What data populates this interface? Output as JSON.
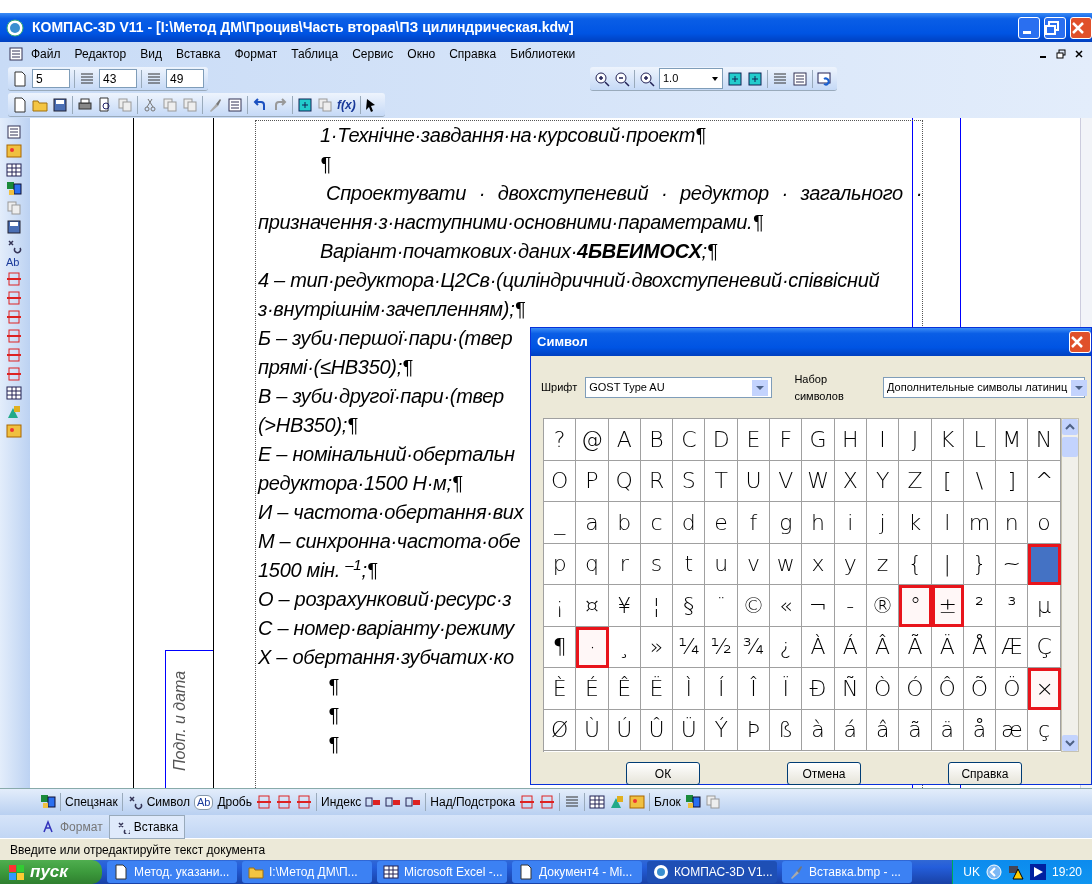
{
  "window": {
    "title": "КОМПАС-3D V11 - [I:\\Метод ДМ\\Процив\\Часть вторая\\ПЗ цилиндрическая.kdw]"
  },
  "menu": [
    "Файл",
    "Редактор",
    "Вид",
    "Вставка",
    "Формат",
    "Таблица",
    "Сервис",
    "Окно",
    "Справка",
    "Библиотеки"
  ],
  "toolbar": {
    "fields": [
      "5",
      "43",
      "49"
    ],
    "zoom": "1.0",
    "formula_button": "f(x)"
  },
  "side_toolbar": {
    "fraction_icon_text": "Ab"
  },
  "document": {
    "stamp_label": "Подп. и дата",
    "lines": [
      {
        "kind": "indented",
        "text": "1·Технічне·завдання·на·курсовий·проект¶"
      },
      {
        "kind": "indented",
        "text": "¶"
      },
      {
        "kind": "justified",
        "text": "Спроектувати · двохступеневий · редуктор · загального ·"
      },
      {
        "kind": "plain",
        "text": "призначення·з·наступними·основними·параметрами.¶"
      },
      {
        "kind": "indented",
        "text": "Варіант·початкових·даних·**4БВЕИМОСХ**;¶"
      },
      {
        "kind": "plain",
        "text": "4 – тип·редуктора·Ц2Св·(циліндричний·двохступеневий·співвісний"
      },
      {
        "kind": "plain",
        "text": "з·внутрішнім·зачепленням);¶"
      },
      {
        "kind": "plain",
        "text": "Б – зуби·першої·пари·(твер"
      },
      {
        "kind": "plain",
        "text": "прямі·(≤HB350);¶"
      },
      {
        "kind": "plain",
        "text": "В – зуби·другої·пари·(твер"
      },
      {
        "kind": "plain",
        "text": "(>HB350);¶"
      },
      {
        "kind": "plain",
        "text": "Е – номінальний·обертальн"
      },
      {
        "kind": "plain",
        "text": "редуктора·1500 Н·м;¶"
      },
      {
        "kind": "plain",
        "text": "И – частота·обертання·вих"
      },
      {
        "kind": "plain",
        "text": "М – синхронна·частота·обе"
      },
      {
        "kind": "plain",
        "text": "1500 мін. $^{–1}$;¶"
      },
      {
        "kind": "plain",
        "text": "О – розрахунковий·ресурс·з"
      },
      {
        "kind": "plain",
        "text": "С – номер·варіанту·режиму"
      },
      {
        "kind": "plain",
        "text": "Х – обертання·зубчатих·ко"
      },
      {
        "kind": "deep",
        "text": "¶"
      },
      {
        "kind": "deep",
        "text": "¶"
      },
      {
        "kind": "deep",
        "text": "¶"
      }
    ]
  },
  "dialog": {
    "title": "Символ",
    "font_label": "Шрифт",
    "font": "GOST Type AU",
    "set_label": "Набор символов",
    "set": "Дополнительные символы латиниц",
    "grid": [
      [
        {
          "char": "?",
          "selected": false,
          "highlighted": false
        },
        {
          "char": "@",
          "selected": false,
          "highlighted": false
        },
        {
          "char": "A",
          "selected": false,
          "highlighted": false
        },
        {
          "char": "B",
          "selected": false,
          "highlighted": false
        },
        {
          "char": "C",
          "selected": false,
          "highlighted": false
        },
        {
          "char": "D",
          "selected": false,
          "highlighted": false
        },
        {
          "char": "E",
          "selected": false,
          "highlighted": false
        },
        {
          "char": "F",
          "selected": false,
          "highlighted": false
        },
        {
          "char": "G",
          "selected": false,
          "highlighted": false
        },
        {
          "char": "H",
          "selected": false,
          "highlighted": false
        },
        {
          "char": "I",
          "selected": false,
          "highlighted": false
        },
        {
          "char": "J",
          "selected": false,
          "highlighted": false
        },
        {
          "char": "K",
          "selected": false,
          "highlighted": false
        },
        {
          "char": "L",
          "selected": false,
          "highlighted": false
        },
        {
          "char": "M",
          "selected": false,
          "highlighted": false
        },
        {
          "char": "N",
          "selected": false,
          "highlighted": false
        }
      ],
      [
        {
          "char": "O",
          "selected": false,
          "highlighted": false
        },
        {
          "char": "P",
          "selected": false,
          "highlighted": false
        },
        {
          "char": "Q",
          "selected": false,
          "highlighted": false
        },
        {
          "char": "R",
          "selected": false,
          "highlighted": false
        },
        {
          "char": "S",
          "selected": false,
          "highlighted": false
        },
        {
          "char": "T",
          "selected": false,
          "highlighted": false
        },
        {
          "char": "U",
          "selected": false,
          "highlighted": false
        },
        {
          "char": "V",
          "selected": false,
          "highlighted": false
        },
        {
          "char": "W",
          "selected": false,
          "highlighted": false
        },
        {
          "char": "X",
          "selected": false,
          "highlighted": false
        },
        {
          "char": "Y",
          "selected": false,
          "highlighted": false
        },
        {
          "char": "Z",
          "selected": false,
          "highlighted": false
        },
        {
          "char": "[",
          "selected": false,
          "highlighted": false
        },
        {
          "char": "\\",
          "selected": false,
          "highlighted": false
        },
        {
          "char": "]",
          "selected": false,
          "highlighted": false
        },
        {
          "char": "^",
          "selected": false,
          "highlighted": false
        }
      ],
      [
        {
          "char": "_",
          "selected": false,
          "highlighted": false
        },
        {
          "char": "a",
          "selected": false,
          "highlighted": false
        },
        {
          "char": "b",
          "selected": false,
          "highlighted": false
        },
        {
          "char": "c",
          "selected": false,
          "highlighted": false
        },
        {
          "char": "d",
          "selected": false,
          "highlighted": false
        },
        {
          "char": "e",
          "selected": false,
          "highlighted": false
        },
        {
          "char": "f",
          "selected": false,
          "highlighted": false
        },
        {
          "char": "g",
          "selected": false,
          "highlighted": false
        },
        {
          "char": "h",
          "selected": false,
          "highlighted": false
        },
        {
          "char": "i",
          "selected": false,
          "highlighted": false
        },
        {
          "char": "j",
          "selected": false,
          "highlighted": false
        },
        {
          "char": "k",
          "selected": false,
          "highlighted": false
        },
        {
          "char": "l",
          "selected": false,
          "highlighted": false
        },
        {
          "char": "m",
          "selected": false,
          "highlighted": false
        },
        {
          "char": "n",
          "selected": false,
          "highlighted": false
        },
        {
          "char": "o",
          "selected": false,
          "highlighted": false
        }
      ],
      [
        {
          "char": "p",
          "selected": false,
          "highlighted": false
        },
        {
          "char": "q",
          "selected": false,
          "highlighted": false
        },
        {
          "char": "r",
          "selected": false,
          "highlighted": false
        },
        {
          "char": "s",
          "selected": false,
          "highlighted": false
        },
        {
          "char": "t",
          "selected": false,
          "highlighted": false
        },
        {
          "char": "u",
          "selected": false,
          "highlighted": false
        },
        {
          "char": "v",
          "selected": false,
          "highlighted": false
        },
        {
          "char": "w",
          "selected": false,
          "highlighted": false
        },
        {
          "char": "x",
          "selected": false,
          "highlighted": false
        },
        {
          "char": "y",
          "selected": false,
          "highlighted": false
        },
        {
          "char": "z",
          "selected": false,
          "highlighted": false
        },
        {
          "char": "{",
          "selected": false,
          "highlighted": false
        },
        {
          "char": "|",
          "selected": false,
          "highlighted": false
        },
        {
          "char": "}",
          "selected": false,
          "highlighted": false
        },
        {
          "char": "~",
          "selected": false,
          "highlighted": false
        },
        {
          "selected": true,
          "highlighted": true
        }
      ],
      [
        {
          "char": "¡",
          "selected": false,
          "highlighted": false
        },
        {
          "char": "¤",
          "selected": false,
          "highlighted": false
        },
        {
          "char": "¥",
          "selected": false,
          "highlighted": false
        },
        {
          "char": "¦",
          "selected": false,
          "highlighted": false
        },
        {
          "char": "§",
          "selected": false,
          "highlighted": false
        },
        {
          "char": "¨",
          "selected": false,
          "highlighted": false
        },
        {
          "char": "©",
          "selected": false,
          "highlighted": false
        },
        {
          "char": "«",
          "selected": false,
          "highlighted": false
        },
        {
          "char": "¬",
          "selected": false,
          "highlighted": false
        },
        {
          "char": "-",
          "selected": false,
          "highlighted": false
        },
        {
          "char": "®",
          "selected": false,
          "highlighted": false
        },
        {
          "char": "°",
          "selected": false,
          "highlighted": true
        },
        {
          "char": "±",
          "selected": false,
          "highlighted": true
        },
        {
          "char": "²",
          "selected": false,
          "highlighted": false
        },
        {
          "char": "³",
          "selected": false,
          "highlighted": false
        },
        {
          "char": "µ",
          "selected": false,
          "highlighted": false
        }
      ],
      [
        {
          "char": "¶",
          "selected": false,
          "highlighted": false
        },
        {
          "char": "·",
          "selected": false,
          "highlighted": true
        },
        {
          "char": "¸",
          "selected": false,
          "highlighted": false
        },
        {
          "char": "»",
          "selected": false,
          "highlighted": false
        },
        {
          "char": "¼",
          "selected": false,
          "highlighted": false
        },
        {
          "char": "½",
          "selected": false,
          "highlighted": false
        },
        {
          "char": "¾",
          "selected": false,
          "highlighted": false
        },
        {
          "char": "¿",
          "selected": false,
          "highlighted": false
        },
        {
          "char": "À",
          "selected": false,
          "highlighted": false
        },
        {
          "char": "Á",
          "selected": false,
          "highlighted": false
        },
        {
          "char": "Â",
          "selected": false,
          "highlighted": false
        },
        {
          "char": "Ã",
          "selected": false,
          "highlighted": false
        },
        {
          "char": "Ä",
          "selected": false,
          "highlighted": false
        },
        {
          "char": "Å",
          "selected": false,
          "highlighted": false
        },
        {
          "char": "Æ",
          "selected": false,
          "highlighted": false
        },
        {
          "char": "Ç",
          "selected": false,
          "highlighted": false
        }
      ],
      [
        {
          "char": "È",
          "selected": false,
          "highlighted": false
        },
        {
          "char": "É",
          "selected": false,
          "highlighted": false
        },
        {
          "char": "Ê",
          "selected": false,
          "highlighted": false
        },
        {
          "char": "Ë",
          "selected": false,
          "highlighted": false
        },
        {
          "char": "Ì",
          "selected": false,
          "highlighted": false
        },
        {
          "char": "Í",
          "selected": false,
          "highlighted": false
        },
        {
          "char": "Î",
          "selected": false,
          "highlighted": false
        },
        {
          "char": "Ï",
          "selected": false,
          "highlighted": false
        },
        {
          "char": "Ð",
          "selected": false,
          "highlighted": false
        },
        {
          "char": "Ñ",
          "selected": false,
          "highlighted": false
        },
        {
          "char": "Ò",
          "selected": false,
          "highlighted": false
        },
        {
          "char": "Ó",
          "selected": false,
          "highlighted": false
        },
        {
          "char": "Ô",
          "selected": false,
          "highlighted": false
        },
        {
          "char": "Õ",
          "selected": false,
          "highlighted": false
        },
        {
          "char": "Ö",
          "selected": false,
          "highlighted": false
        },
        {
          "char": "×",
          "selected": false,
          "highlighted": true
        }
      ],
      [
        {
          "char": "Ø",
          "selected": false,
          "highlighted": false
        },
        {
          "char": "Ù",
          "selected": false,
          "highlighted": false
        },
        {
          "char": "Ú",
          "selected": false,
          "highlighted": false
        },
        {
          "char": "Û",
          "selected": false,
          "highlighted": false
        },
        {
          "char": "Ü",
          "selected": false,
          "highlighted": false
        },
        {
          "char": "Ý",
          "selected": false,
          "highlighted": false
        },
        {
          "char": "Þ",
          "selected": false,
          "highlighted": false
        },
        {
          "char": "ß",
          "selected": false,
          "highlighted": false
        },
        {
          "char": "à",
          "selected": false,
          "highlighted": false
        },
        {
          "char": "á",
          "selected": false,
          "highlighted": false
        },
        {
          "char": "â",
          "selected": false,
          "highlighted": false
        },
        {
          "char": "ã",
          "selected": false,
          "highlighted": false
        },
        {
          "char": "ä",
          "selected": false,
          "highlighted": false
        },
        {
          "char": "å",
          "selected": false,
          "highlighted": false
        },
        {
          "char": "æ",
          "selected": false,
          "highlighted": false
        },
        {
          "char": "ç",
          "selected": false,
          "highlighted": false
        }
      ]
    ],
    "buttons": [
      "ОК",
      "Отмена",
      "Справка"
    ]
  },
  "format_toolbar": {
    "fraction_icon_text": "Ab",
    "labels": [
      "Спецзнак",
      "Символ",
      "Дробь",
      "Индекс",
      "Над/Подстрока",
      "Блок"
    ]
  },
  "tabs": [
    {
      "label": "Формат",
      "selected": false
    },
    {
      "label": "Вставка",
      "selected": true
    }
  ],
  "status_bar": "Введите или отредактируйте текст документа",
  "taskbar": {
    "start": "пуск",
    "tasks": [
      {
        "label": "Метод. указани...",
        "selected": false
      },
      {
        "label": "I:\\Метод ДМ\\П...",
        "selected": false
      },
      {
        "label": "Microsoft Excel -...",
        "selected": false
      },
      {
        "label": "Документ4 - Mi...",
        "selected": false
      },
      {
        "label": "КОМПАС-3D V1...",
        "selected": true
      },
      {
        "label": "Вставка.bmp - ...",
        "selected": false
      }
    ],
    "language": "UK",
    "clock": "19:20"
  }
}
